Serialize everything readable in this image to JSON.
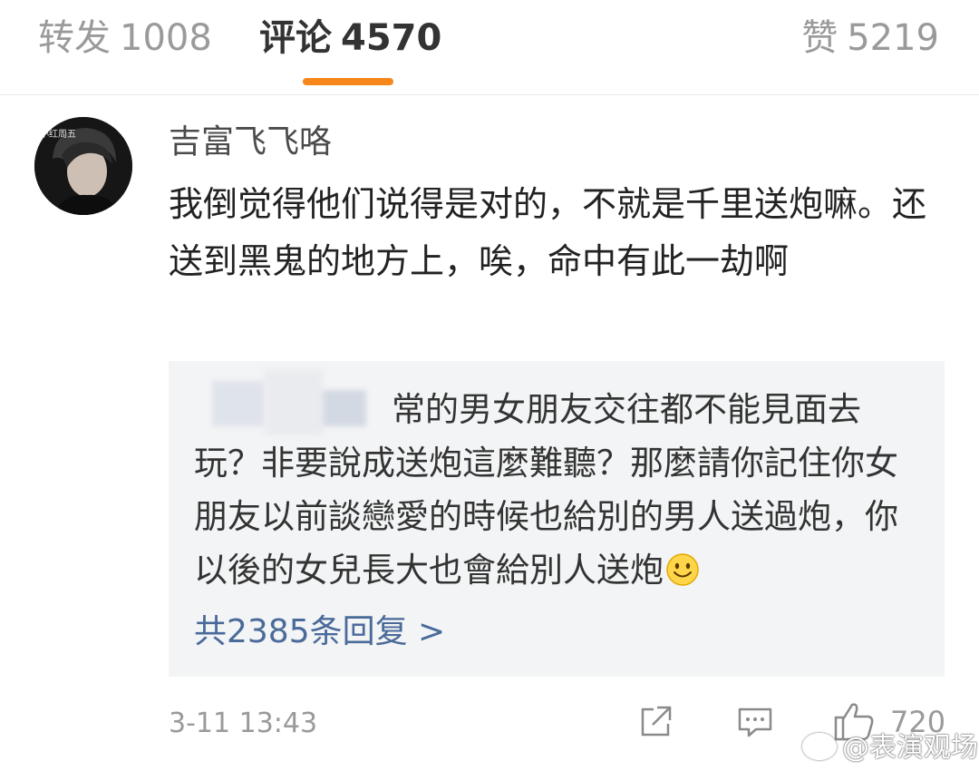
{
  "tabs": {
    "repost": {
      "label": "转发",
      "count": "1008"
    },
    "comments": {
      "label": "评论",
      "count": "4570"
    },
    "likes": {
      "label": "赞",
      "count": "5219"
    }
  },
  "comment": {
    "avatar_text": "小红周五",
    "username": "吉富飞飞咯",
    "text": "我倒觉得他们说得是对的，不就是千里送炮嘛。还送到黑鬼的地方上，唉，命中有此一劫啊",
    "timestamp": "3-11 13:43",
    "like_count": "720"
  },
  "reply": {
    "text": "常的男女朋友交往都不能見面去玩？非要說成送炮這麼難聽？那麼請你記住你女朋友以前談戀愛的時候也給別的男人送過炮，你以後的女兒長大也會給別人送炮",
    "emoji": "smile-emoji",
    "more_label": "共2385条回复 >"
  },
  "watermark": "@表演观场",
  "colors": {
    "accent": "#f7861b",
    "link": "#4a6a9a",
    "muted": "#9a9a9a",
    "reply_bg": "#f3f4f5"
  }
}
